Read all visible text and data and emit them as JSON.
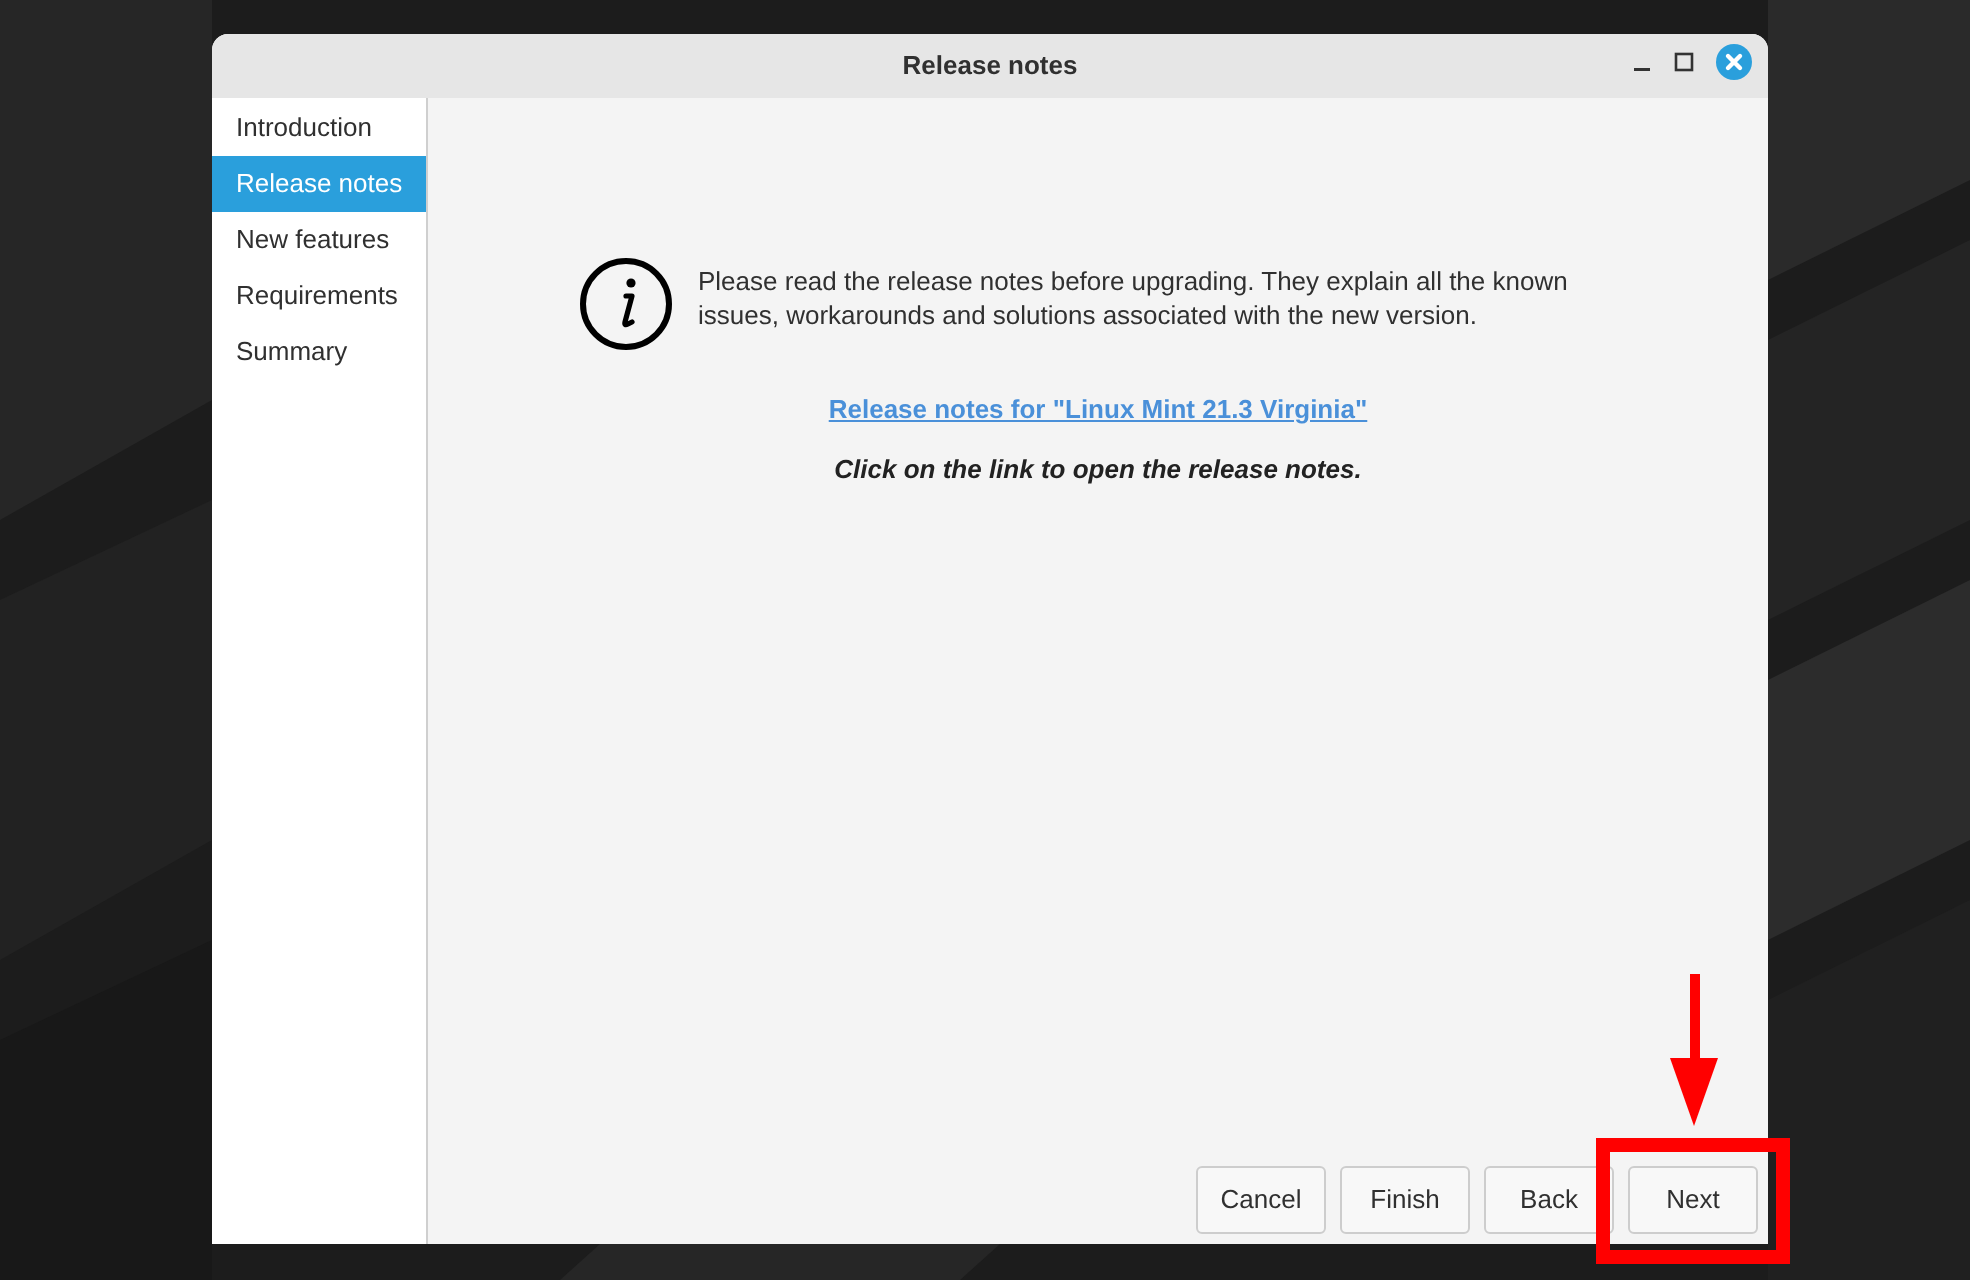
{
  "window": {
    "title": "Release notes"
  },
  "sidebar": {
    "items": [
      {
        "label": "Introduction",
        "selected": false
      },
      {
        "label": "Release notes",
        "selected": true
      },
      {
        "label": "New features",
        "selected": false
      },
      {
        "label": "Requirements",
        "selected": false
      },
      {
        "label": "Summary",
        "selected": false
      }
    ]
  },
  "content": {
    "message": "Please read the release notes before upgrading. They explain all the known issues, workarounds and solutions associated with the new version.",
    "link": "Release notes for \"Linux Mint 21.3 Virginia\"",
    "hint": "Click on the link to open the release notes."
  },
  "buttons": [
    {
      "label": "Cancel",
      "highlighted": false
    },
    {
      "label": "Finish",
      "highlighted": false
    },
    {
      "label": "Back",
      "highlighted": false
    },
    {
      "label": "Next",
      "highlighted": true
    }
  ]
}
